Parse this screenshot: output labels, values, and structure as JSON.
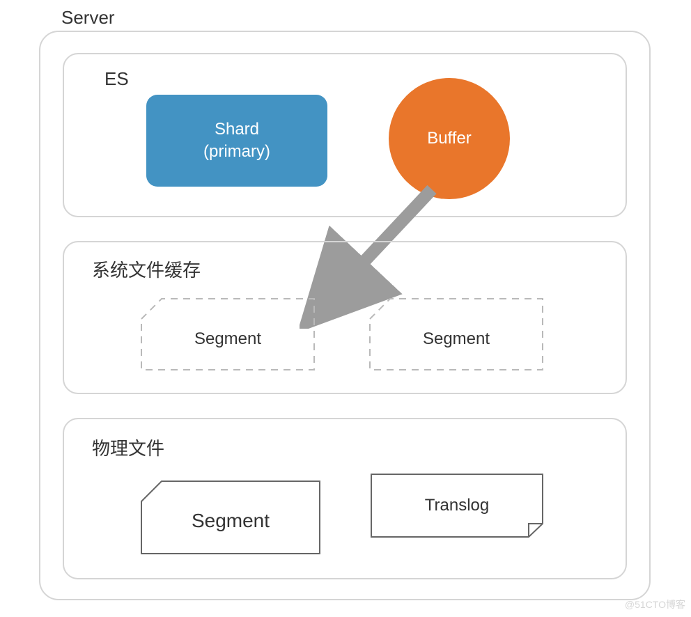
{
  "server": {
    "label": "Server"
  },
  "es": {
    "label": "ES",
    "shard": {
      "line1": "Shard",
      "line2": "(primary)"
    },
    "buffer": "Buffer"
  },
  "cache": {
    "label": "系统文件缓存",
    "segments": [
      "Segment",
      "Segment"
    ]
  },
  "disk": {
    "label": "物理文件",
    "segment": "Segment",
    "translog": "Translog"
  },
  "watermark": "@51CTO博客"
}
